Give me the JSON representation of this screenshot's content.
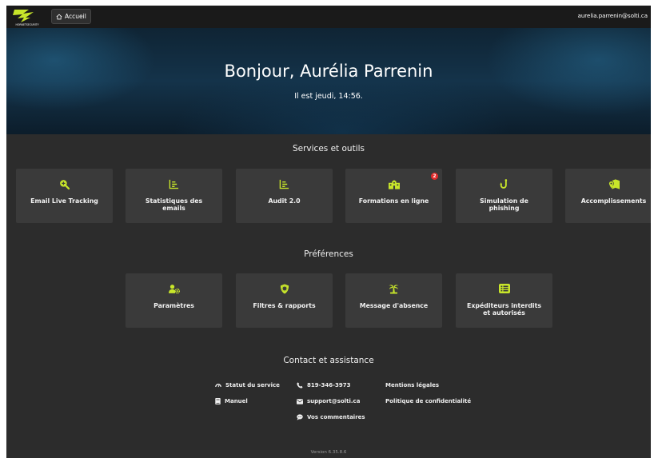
{
  "topbar": {
    "logo_text": "HORNETSECURITY",
    "home_label": "Accueil",
    "user_email": "aurelia.parrenin@solti.ca"
  },
  "hero": {
    "title": "Bonjour, Aurélia Parrenin",
    "subtitle": "Il est jeudi, 14:56."
  },
  "services": {
    "title": "Services et outils",
    "tiles": [
      {
        "label": "Email Live Tracking",
        "icon": "magnify-plus-icon"
      },
      {
        "label": "Statistiques des emails",
        "icon": "chart-icon"
      },
      {
        "label": "Audit 2.0",
        "icon": "chart-icon"
      },
      {
        "label": "Formations en ligne",
        "icon": "school-icon",
        "badge": "2"
      },
      {
        "label": "Simulation de phishing",
        "icon": "hook-icon"
      },
      {
        "label": "Accomplissements",
        "icon": "map-marker-icon"
      }
    ]
  },
  "preferences": {
    "title": "Préférences",
    "tiles": [
      {
        "label": "Paramètres",
        "icon": "user-gear-icon"
      },
      {
        "label": "Filtres & rapports",
        "icon": "shield-virus-icon"
      },
      {
        "label": "Message d'absence",
        "icon": "palm-tree-icon"
      },
      {
        "label": "Expéditeurs interdits et autorisés",
        "icon": "list-icon"
      }
    ]
  },
  "contact": {
    "title": "Contact et assistance",
    "service_status": "Statut du service",
    "manual": "Manuel",
    "phone": "819-346-3973",
    "email": "support@solti.ca",
    "feedback": "Vos commentaires",
    "legal": "Mentions légales",
    "privacy": "Politique de confidentialité"
  },
  "footer": {
    "version": "Version 6.35.8.6"
  },
  "colors": {
    "accent": "#c8e62a",
    "badge": "#e22b2b",
    "tile_bg": "#3a3a3a",
    "page_bg": "#2c2c2c"
  }
}
